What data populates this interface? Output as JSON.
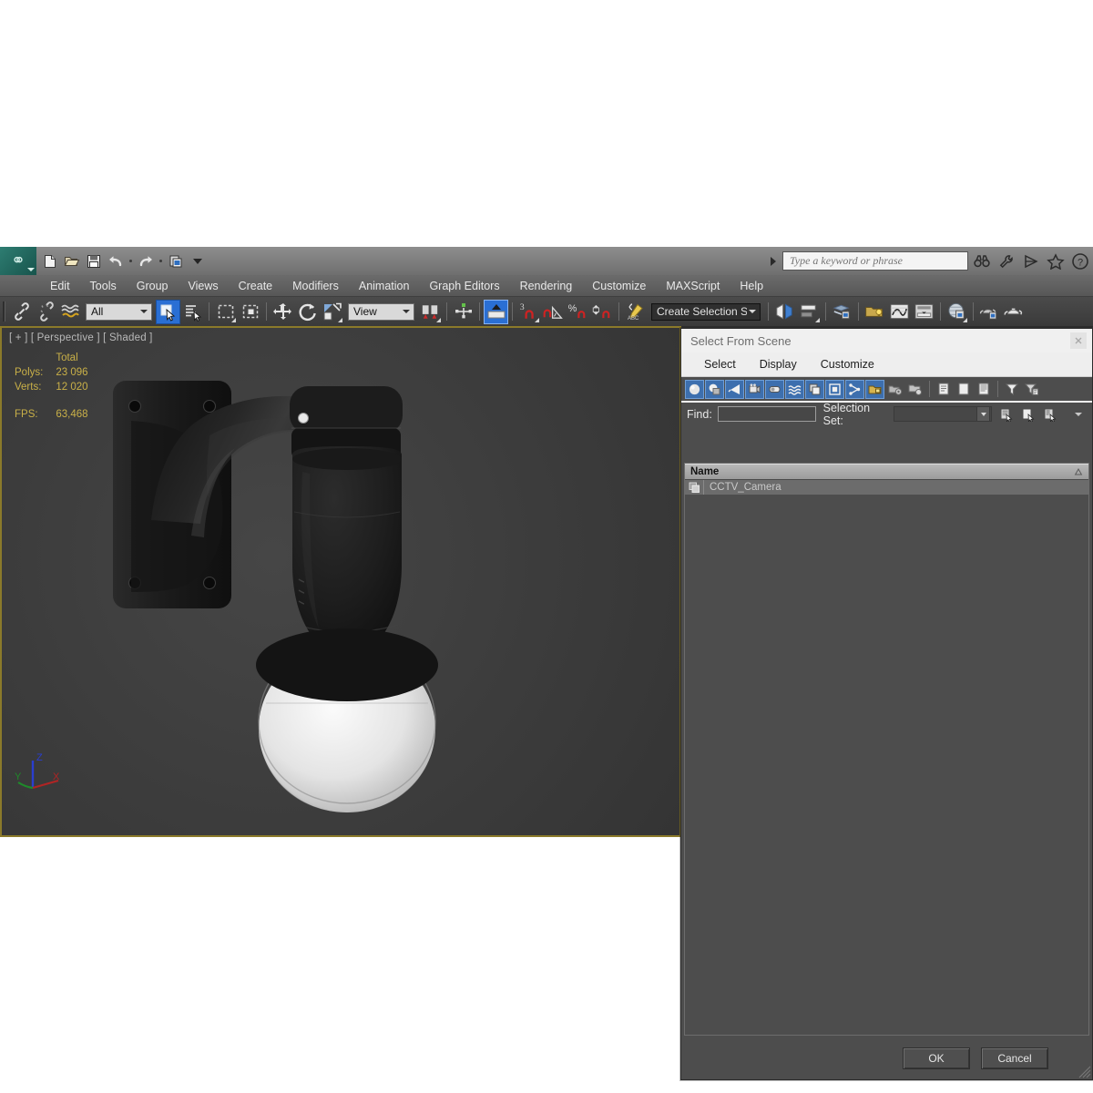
{
  "app": {
    "logo_icon": "3dsmax-logo-icon",
    "quick_access": [
      {
        "name": "new-file-button",
        "icon": "new-file-icon"
      },
      {
        "name": "open-file-button",
        "icon": "open-folder-icon"
      },
      {
        "name": "save-file-button",
        "icon": "save-disk-icon"
      },
      {
        "name": "undo-button",
        "icon": "undo-arrow-icon"
      },
      {
        "name": "undo-dropdown-button",
        "icon": "dropdown-dot-icon"
      },
      {
        "name": "redo-button",
        "icon": "redo-arrow-icon"
      },
      {
        "name": "redo-dropdown-button",
        "icon": "dropdown-dot-icon"
      },
      {
        "name": "project-folder-button",
        "icon": "project-folder-icon"
      },
      {
        "name": "quick-access-overflow-button",
        "icon": "chevron-down-icon"
      }
    ],
    "search": {
      "placeholder": "Type a keyword or phrase",
      "expand_icon": "right-arrow-icon",
      "icons": [
        "binoculars-icon",
        "wrench-icon",
        "satellite-dish-icon",
        "star-icon",
        "help-question-icon"
      ]
    }
  },
  "menubar": {
    "items": [
      {
        "label": "Edit"
      },
      {
        "label": "Tools"
      },
      {
        "label": "Group"
      },
      {
        "label": "Views"
      },
      {
        "label": "Create"
      },
      {
        "label": "Modifiers"
      },
      {
        "label": "Animation"
      },
      {
        "label": "Graph Editors"
      },
      {
        "label": "Rendering"
      },
      {
        "label": "Customize"
      },
      {
        "label": "MAXScript"
      },
      {
        "label": "Help"
      }
    ]
  },
  "toolbar": {
    "selection_filter": {
      "value": "All",
      "label": "selection-filter-combo"
    },
    "transform_ref": {
      "value": "View",
      "label": "reference-coordinate-system-combo"
    },
    "named_selection_set": {
      "value": "Create Selection Se",
      "label": "named-selection-sets-combo"
    },
    "buttons": [
      {
        "name": "select-and-link-button",
        "icon": "link-chain-icon"
      },
      {
        "name": "unlink-selection-button",
        "icon": "broken-chain-icon"
      },
      {
        "name": "bind-to-space-warp-button",
        "icon": "space-warp-icon"
      },
      {
        "name": "select-object-button",
        "icon": "select-arrow-icon",
        "active": true
      },
      {
        "name": "select-by-name-button",
        "icon": "select-by-name-icon"
      },
      {
        "name": "rectangular-selection-region-button",
        "icon": "rectangle-marquee-icon"
      },
      {
        "name": "window-crossing-button",
        "icon": "window-crossing-icon"
      },
      {
        "name": "select-and-move-button",
        "icon": "move-gizmo-icon"
      },
      {
        "name": "select-and-rotate-button",
        "icon": "rotate-gizmo-icon"
      },
      {
        "name": "select-and-scale-button",
        "icon": "scale-gizmo-icon"
      },
      {
        "name": "use-center-flyout-button",
        "icon": "pivot-center-icon"
      },
      {
        "name": "select-and-manipulate-button",
        "icon": "manipulate-icon"
      },
      {
        "name": "snaps-toggle-button",
        "icon": "snap-3d-icon",
        "active": true
      },
      {
        "name": "angle-snap-toggle-button",
        "icon": "angle-snap-icon"
      },
      {
        "name": "percent-snap-toggle-button",
        "icon": "percent-snap-icon"
      },
      {
        "name": "spinner-snap-toggle-button",
        "icon": "spinner-snap-icon"
      },
      {
        "name": "edit-named-selection-sets-button",
        "icon": "named-sets-icon"
      },
      {
        "name": "mirror-button",
        "icon": "mirror-icon"
      },
      {
        "name": "align-button",
        "icon": "align-icon"
      },
      {
        "name": "layer-manager-button",
        "icon": "layer-manager-icon"
      },
      {
        "name": "scene-explorer-button",
        "icon": "scene-explorer-icon"
      },
      {
        "name": "curve-editor-button",
        "icon": "curve-editor-icon"
      },
      {
        "name": "schematic-view-button",
        "icon": "schematic-view-icon"
      },
      {
        "name": "material-editor-button",
        "icon": "material-editor-icon"
      },
      {
        "name": "render-setup-button",
        "icon": "render-setup-icon"
      },
      {
        "name": "rendered-frame-window-button",
        "icon": "teapot-render-icon"
      }
    ]
  },
  "viewport": {
    "label": "[ + ] [ Perspective ] [ Shaded ]",
    "stats": {
      "column_header": "Total",
      "rows": [
        {
          "label": "Polys:",
          "value": "23 096"
        },
        {
          "label": "Verts:",
          "value": "12 020"
        }
      ],
      "fps_label": "FPS:",
      "fps_value": "63,468"
    },
    "axis_gizmo": {
      "z": "Z",
      "y": "Y",
      "x": "X"
    },
    "model_name": "cctv-dome-camera"
  },
  "dialog": {
    "title": "Select From Scene",
    "close_icon": "window-close-icon",
    "menu": [
      {
        "label": "Select"
      },
      {
        "label": "Display"
      },
      {
        "label": "Customize"
      }
    ],
    "toolbar_buttons": [
      {
        "name": "display-geometry-button",
        "icon": "sphere-geometry-icon",
        "on": true
      },
      {
        "name": "display-shapes-button",
        "icon": "shapes-icon",
        "on": true
      },
      {
        "name": "display-lights-button",
        "icon": "light-cone-icon",
        "on": true
      },
      {
        "name": "display-cameras-button",
        "icon": "camera-icon",
        "on": true
      },
      {
        "name": "display-helpers-button",
        "icon": "tape-helper-icon",
        "on": true
      },
      {
        "name": "display-space-warps-button",
        "icon": "space-warp-wave-icon",
        "on": true
      },
      {
        "name": "display-groups-button",
        "icon": "group-icon",
        "on": true
      },
      {
        "name": "display-xrefs-button",
        "icon": "xref-square-icon",
        "on": true
      },
      {
        "name": "display-bones-button",
        "icon": "bone-chain-icon",
        "on": true
      },
      {
        "name": "display-containers-button",
        "icon": "container-lock-icon",
        "on": true
      },
      {
        "name": "display-children-button",
        "icon": "children-gear-icon",
        "on": false
      },
      {
        "name": "display-influences-button",
        "icon": "influences-icon",
        "on": false
      },
      {
        "name": "expand-all-button",
        "icon": "list-lines-icon",
        "on": false
      },
      {
        "name": "collapse-all-button",
        "icon": "blank-page-icon",
        "on": false
      },
      {
        "name": "expand-selected-button",
        "icon": "page-lines-icon",
        "on": false
      },
      {
        "name": "filter-button",
        "icon": "funnel-filter-icon",
        "on": false
      },
      {
        "name": "filter-settings-button",
        "icon": "funnel-settings-icon",
        "on": false
      }
    ],
    "find": {
      "label": "Find:",
      "value": "",
      "placeholder": ""
    },
    "selection_set": {
      "label": "Selection Set:",
      "value": "",
      "dropdown_icon": "chevron-down-icon"
    },
    "find_row_icons": [
      {
        "name": "select-children-button",
        "icon": "select-children-icon"
      },
      {
        "name": "select-influences-button",
        "icon": "select-influences-icon"
      },
      {
        "name": "select-dependents-button",
        "icon": "select-dependents-icon"
      },
      {
        "name": "list-options-button",
        "icon": "chevron-down-small-icon"
      }
    ],
    "list": {
      "header": "Name",
      "sort_icon": "sort-ascending-icon",
      "rows": [
        {
          "name": "CCTV_Camera",
          "icon": "group-object-icon",
          "selected": true
        }
      ]
    },
    "footer": {
      "ok_label": "OK",
      "cancel_label": "Cancel"
    },
    "resize_handle_icon": "resize-grip-icon"
  },
  "colors": {
    "accent_blue": "#2a6fd4",
    "viewport_border": "#8b7a2a",
    "stats_yellow": "#c9b048",
    "dialog_bg": "#4d4d4d",
    "toolbar_bg": "#3f3f3f"
  }
}
